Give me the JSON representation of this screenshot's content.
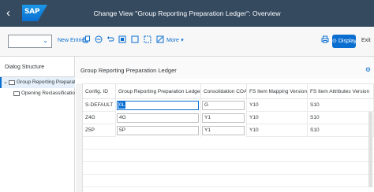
{
  "shell": {
    "back_glyph": "‹",
    "logo_text": "SAP",
    "title": "Change View \"Group Reporting Preparation Ledger\": Overview"
  },
  "toolbar": {
    "new_entries": "New Entries",
    "more": "More",
    "display": "Display",
    "exit": "Exit",
    "icons": [
      "copy-icon",
      "delete-icon",
      "undo-icon",
      "select-all-icon",
      "deselect-all-icon",
      "select-block-icon",
      "print-icon"
    ]
  },
  "dialog": {
    "title": "Dialog Structure",
    "items": [
      {
        "label": "Group Reporting Preparation Ledger",
        "expanded": true,
        "selected": true
      },
      {
        "label": "Opening Reclassification Subitem",
        "expanded": false,
        "selected": false
      }
    ]
  },
  "panel": {
    "title": "Group Reporting Preparation Ledger"
  },
  "table": {
    "columns": [
      "Config. ID",
      "Group Reporting Preparation Ledger",
      "Consolidation COA",
      "FS Item Mapping Version",
      "FS Item Attributes Version"
    ],
    "rows": [
      [
        "S-DEFAULT",
        "0L",
        "G",
        "Y10",
        "S10"
      ],
      [
        "Z4G",
        "4G",
        "Y1",
        "Y10",
        "S10"
      ],
      [
        "Z5P",
        "5P",
        "Y1",
        "Y10",
        "S10"
      ]
    ]
  },
  "colors": {
    "shell": "#354a5f",
    "accent": "#0a6ed1",
    "selection": "#e5f0fa"
  }
}
